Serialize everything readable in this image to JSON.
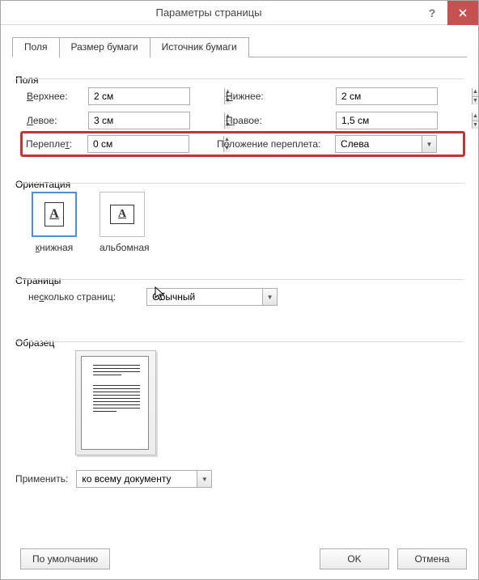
{
  "title": "Параметры страницы",
  "tabs": {
    "fields": "Поля",
    "paper": "Размер бумаги",
    "source": "Источник бумаги"
  },
  "groups": {
    "fields": "Поля",
    "orientation": "Ориентация",
    "pages": "Страницы",
    "sample": "Образец"
  },
  "labels": {
    "top": "Верхнее:",
    "bottom": "Нижнее:",
    "left": "Левое:",
    "right": "Правое:",
    "gutter": "Переплет:",
    "gutterPos": "Положение переплета:",
    "portrait": "книжная",
    "landscape": "альбомная",
    "multi": "несколько страниц:",
    "apply": "Применить:"
  },
  "values": {
    "top": "2 см",
    "bottom": "2 см",
    "left": "3 см",
    "right": "1,5 см",
    "gutter": "0 см",
    "gutterPos": "Слева",
    "multi": "Обычный",
    "apply": "ко всему документу"
  },
  "buttons": {
    "default": "По умолчанию",
    "ok": "OK",
    "cancel": "Отмена"
  },
  "icons": {
    "pageA": "A"
  }
}
